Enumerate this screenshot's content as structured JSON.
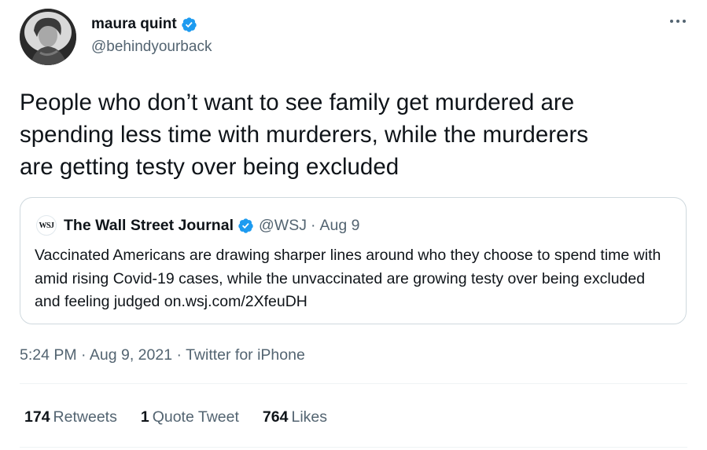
{
  "author": {
    "display_name": "maura quint",
    "handle": "@behindyourback",
    "verified": true
  },
  "tweet": {
    "text": "People who don’t want to see family get murdered are\nspending less time with murderers, while the murderers\nare getting testy over being excluded"
  },
  "quoted_tweet": {
    "logo_text": "WSJ",
    "display_name": "The Wall Street Journal",
    "handle": "@WSJ",
    "separator": "·",
    "date": "Aug 9",
    "text": "Vaccinated Americans are drawing sharper lines around who they choose to spend time with amid rising Covid-19 cases, while the unvaccinated are growing testy over being excluded and feeling judged on.wsj.com/2XfeuDH"
  },
  "meta": {
    "time": "5:24 PM",
    "sep1": "·",
    "date": "Aug 9, 2021",
    "sep2": "·",
    "source": "Twitter for iPhone"
  },
  "stats": {
    "retweets_count": "174",
    "retweets_label": "Retweets",
    "quotes_count": "1",
    "quotes_label": "Quote Tweet",
    "likes_count": "764",
    "likes_label": "Likes"
  },
  "colors": {
    "verified_blue": "#1d9bf0",
    "secondary_text": "#536471",
    "border": "#cfd9de"
  }
}
